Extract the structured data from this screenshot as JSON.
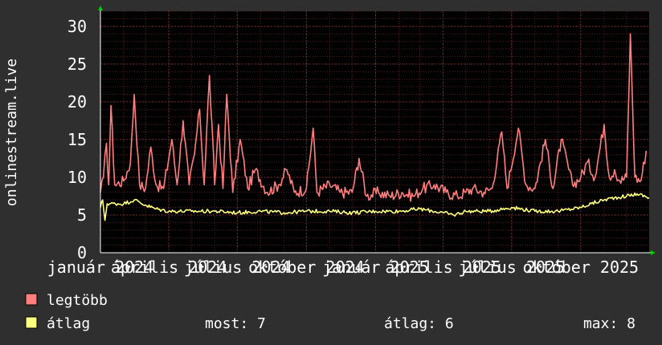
{
  "chart_data": {
    "type": "line",
    "ylabel": "onlinestream.live",
    "ylim": [
      0,
      32
    ],
    "yticks": [
      0,
      5,
      10,
      15,
      20,
      25,
      30
    ],
    "x_tick_labels": [
      "január 2024",
      "április 2024",
      "július 2024",
      "október 2024",
      "január 2025",
      "április 2025",
      "július 2025",
      "október 2025"
    ],
    "x_range": [
      "2024-01-01",
      "2025-12-31"
    ],
    "grid": true,
    "legend_position": "bottom-left",
    "series": [
      {
        "name": "legtöbb",
        "color": "#ff7f7f",
        "keypoints": [
          [
            "2024-01-01",
            8
          ],
          [
            "2024-01-05",
            10
          ],
          [
            "2024-01-09",
            14.5
          ],
          [
            "2024-01-12",
            9
          ],
          [
            "2024-01-15",
            19.5
          ],
          [
            "2024-01-20",
            9
          ],
          [
            "2024-02-01",
            9.5
          ],
          [
            "2024-02-10",
            12
          ],
          [
            "2024-02-15",
            21
          ],
          [
            "2024-02-22",
            9
          ],
          [
            "2024-03-01",
            8.5
          ],
          [
            "2024-03-08",
            14
          ],
          [
            "2024-03-15",
            9
          ],
          [
            "2024-03-25",
            8.5
          ],
          [
            "2024-04-05",
            15
          ],
          [
            "2024-04-12",
            9
          ],
          [
            "2024-04-20",
            17.5
          ],
          [
            "2024-04-28",
            9
          ],
          [
            "2024-05-05",
            13
          ],
          [
            "2024-05-12",
            19
          ],
          [
            "2024-05-18",
            9
          ],
          [
            "2024-05-25",
            23.5
          ],
          [
            "2024-06-01",
            9
          ],
          [
            "2024-06-06",
            17
          ],
          [
            "2024-06-12",
            8.5
          ],
          [
            "2024-06-17",
            21
          ],
          [
            "2024-06-25",
            8
          ],
          [
            "2024-07-05",
            15
          ],
          [
            "2024-07-15",
            8.5
          ],
          [
            "2024-07-25",
            11
          ],
          [
            "2024-08-10",
            8
          ],
          [
            "2024-08-25",
            9
          ],
          [
            "2024-09-05",
            11
          ],
          [
            "2024-09-15",
            8
          ],
          [
            "2024-10-01",
            8.5
          ],
          [
            "2024-10-10",
            16.5
          ],
          [
            "2024-10-15",
            8
          ],
          [
            "2024-11-01",
            9
          ],
          [
            "2024-11-15",
            8
          ],
          [
            "2024-12-01",
            8
          ],
          [
            "2024-12-10",
            12.5
          ],
          [
            "2024-12-20",
            7.5
          ],
          [
            "2025-01-05",
            8
          ],
          [
            "2025-01-20",
            7.5
          ],
          [
            "2025-02-05",
            8
          ],
          [
            "2025-02-20",
            7.5
          ],
          [
            "2025-03-05",
            8.5
          ],
          [
            "2025-03-20",
            9
          ],
          [
            "2025-04-05",
            8
          ],
          [
            "2025-04-20",
            7.5
          ],
          [
            "2025-05-01",
            8
          ],
          [
            "2025-05-10",
            8.5
          ],
          [
            "2025-05-25",
            8
          ],
          [
            "2025-06-05",
            8.5
          ],
          [
            "2025-06-18",
            16
          ],
          [
            "2025-06-25",
            8.5
          ],
          [
            "2025-07-10",
            16.5
          ],
          [
            "2025-07-20",
            9
          ],
          [
            "2025-08-01",
            8.5
          ],
          [
            "2025-08-15",
            15
          ],
          [
            "2025-08-25",
            8.5
          ],
          [
            "2025-09-05",
            15
          ],
          [
            "2025-09-20",
            9
          ],
          [
            "2025-10-01",
            10
          ],
          [
            "2025-10-10",
            12
          ],
          [
            "2025-10-20",
            10
          ],
          [
            "2025-11-01",
            17
          ],
          [
            "2025-11-08",
            10
          ],
          [
            "2025-11-15",
            11
          ],
          [
            "2025-11-22",
            9.5
          ],
          [
            "2025-12-01",
            10
          ],
          [
            "2025-12-06",
            29
          ],
          [
            "2025-12-12",
            10
          ],
          [
            "2025-12-20",
            9.5
          ],
          [
            "2025-12-27",
            13.5
          ]
        ]
      },
      {
        "name": "átlag",
        "color": "#ffff80",
        "keypoints": [
          [
            "2024-01-01",
            6
          ],
          [
            "2024-01-04",
            7
          ],
          [
            "2024-01-07",
            4.3
          ],
          [
            "2024-01-10",
            6.5
          ],
          [
            "2024-02-01",
            6.5
          ],
          [
            "2024-02-15",
            7
          ],
          [
            "2024-03-01",
            6.3
          ],
          [
            "2024-03-15",
            5.8
          ],
          [
            "2024-04-01",
            5.5
          ],
          [
            "2024-05-01",
            5.5
          ],
          [
            "2024-06-01",
            5.5
          ],
          [
            "2024-07-01",
            5.3
          ],
          [
            "2024-08-01",
            5.5
          ],
          [
            "2024-09-01",
            5.3
          ],
          [
            "2024-10-01",
            5.5
          ],
          [
            "2024-11-01",
            5.5
          ],
          [
            "2024-12-01",
            5.3
          ],
          [
            "2025-01-01",
            5.5
          ],
          [
            "2025-02-01",
            5.5
          ],
          [
            "2025-03-01",
            5.8
          ],
          [
            "2025-04-01",
            5.3
          ],
          [
            "2025-04-15",
            5
          ],
          [
            "2025-05-01",
            5.5
          ],
          [
            "2025-06-01",
            5.5
          ],
          [
            "2025-07-01",
            6
          ],
          [
            "2025-08-01",
            5.5
          ],
          [
            "2025-09-01",
            5.5
          ],
          [
            "2025-10-01",
            6
          ],
          [
            "2025-10-15",
            6.5
          ],
          [
            "2025-11-01",
            7
          ],
          [
            "2025-11-15",
            7.3
          ],
          [
            "2025-12-01",
            7.5
          ],
          [
            "2025-12-15",
            7.8
          ],
          [
            "2025-12-31",
            7.3
          ]
        ]
      }
    ]
  },
  "legend": {
    "max_label": "legtöbb",
    "avg_label": "átlag",
    "stats": {
      "now": "most: 7",
      "avg": "átlag: 6",
      "max": "max: 8"
    }
  }
}
